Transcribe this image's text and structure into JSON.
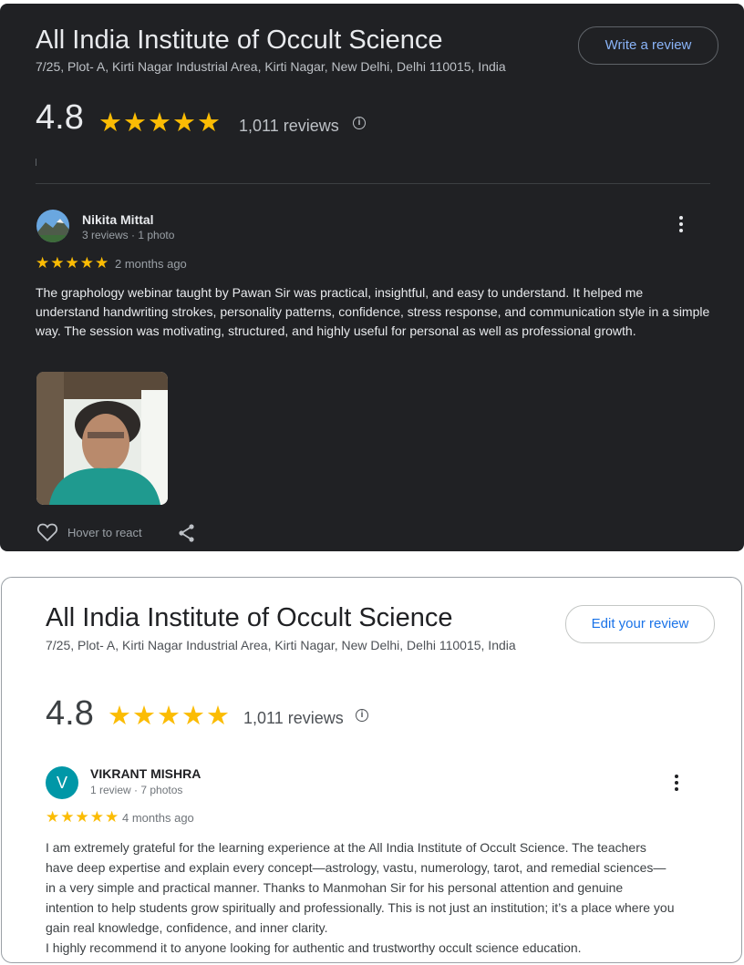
{
  "dark_card": {
    "title": "All India Institute of Occult Science",
    "address": "7/25, Plot- A, Kirti Nagar Industrial Area, Kirti Nagar, New Delhi, Delhi 110015, India",
    "rating": "4.8",
    "stars": "★★★★★",
    "reviews_count": "1,011 reviews",
    "write_review_label": "Write a review",
    "review": {
      "author": "Nikita Mittal",
      "author_meta": "3 reviews · 1 photo",
      "stars": "★★★★★",
      "time": "2 months ago",
      "text": "The graphology webinar taught by Pawan Sir was practical, insightful, and easy to understand. It helped me understand handwriting strokes, personality patterns, confidence, stress response, and communication style in a simple way. The session was motivating, structured, and highly useful for personal as well as professional growth.",
      "react_label": "Hover to react"
    },
    "colors": {
      "background": "#202124",
      "accent_link": "#8ab4f8",
      "star": "#fbbc04"
    }
  },
  "light_card": {
    "title": "All India Institute of Occult Science",
    "address": "7/25, Plot- A, Kirti Nagar Industrial Area, Kirti Nagar, New Delhi, Delhi 110015, India",
    "rating": "4.8",
    "stars": "★★★★★",
    "reviews_count": "1,011 reviews",
    "edit_review_label": "Edit your review",
    "review": {
      "avatar_letter": "V",
      "author": "VIKRANT MISHRA",
      "author_meta": "1 review · 7 photos",
      "stars": "★★★★★",
      "time": "4 months ago",
      "text_lines": [
        "I am extremely grateful for the learning experience at the All India Institute of Occult Science. The teachers have deep expertise and explain every concept—astrology, vastu, numerology, tarot, and remedial sciences—in a very simple and practical manner. Thanks to Manmohan Sir for his personal attention and genuine intention to help students grow spiritually and professionally. This is not just an institution; it’s a place where you gain real knowledge, confidence, and inner clarity.",
        "I highly recommend it to anyone looking for authentic and trustworthy occult science education."
      ]
    },
    "colors": {
      "avatar_bg": "#0097a7",
      "accent_link": "#1a73e8",
      "star": "#fbbc04"
    }
  },
  "icons": [
    "info-icon",
    "more-vert-icon",
    "heart-icon",
    "share-icon"
  ]
}
